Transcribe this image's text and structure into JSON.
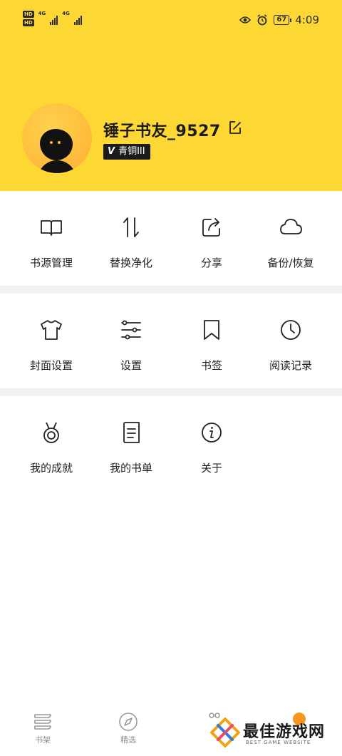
{
  "status_bar": {
    "network_labels": [
      "HD",
      "HD"
    ],
    "network_types": [
      "4G",
      "4G"
    ],
    "battery": "67",
    "time": "4:09"
  },
  "profile": {
    "username": "锤子书友_9527",
    "badge_icon": "V",
    "badge_level": "青铜III"
  },
  "menu_row_1": [
    {
      "label": "书源管理",
      "icon": "book-open-icon"
    },
    {
      "label": "替换净化",
      "icon": "swap-vertical-icon"
    },
    {
      "label": "分享",
      "icon": "share-icon"
    },
    {
      "label": "备份/恢复",
      "icon": "cloud-icon"
    }
  ],
  "menu_row_2": [
    {
      "label": "封面设置",
      "icon": "tshirt-icon"
    },
    {
      "label": "设置",
      "icon": "sliders-icon"
    },
    {
      "label": "书签",
      "icon": "bookmark-icon"
    },
    {
      "label": "阅读记录",
      "icon": "clock-icon"
    }
  ],
  "menu_row_3": [
    {
      "label": "我的成就",
      "icon": "medal-icon"
    },
    {
      "label": "我的书单",
      "icon": "book-list-icon"
    },
    {
      "label": "关于",
      "icon": "info-icon"
    }
  ],
  "tab_bar": [
    {
      "label": "书架",
      "icon": "bookshelf-icon"
    },
    {
      "label": "精选",
      "icon": "compass-icon"
    }
  ],
  "watermark": {
    "title": "最佳游戏网",
    "subtitle": "BEST GAME WEBSITE"
  },
  "colors": {
    "header_bg": "#fdd835",
    "accent": "#f7951e",
    "badge_bg": "#1c1c1c"
  }
}
